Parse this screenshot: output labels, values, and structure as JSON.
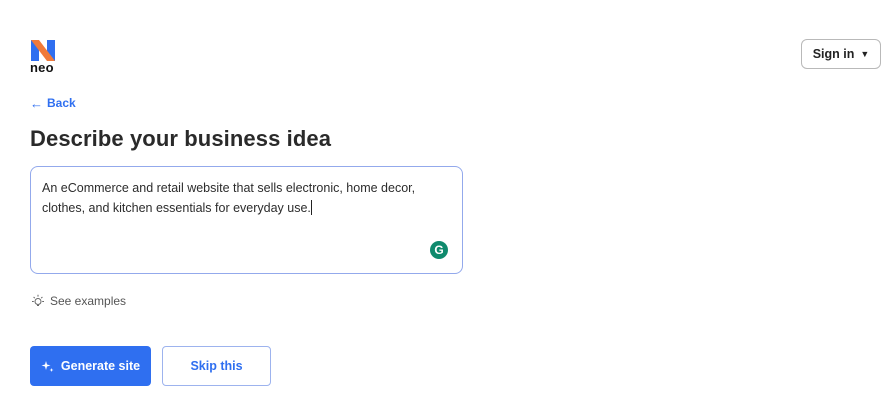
{
  "header": {
    "logo_text": "neo",
    "signin_label": "Sign in",
    "signin_caret": "▼"
  },
  "nav": {
    "back_arrow": "←",
    "back_label": "Back"
  },
  "main": {
    "title": "Describe your business idea",
    "description_value": "An eCommerce and retail website that sells electronic, home decor, clothes, and kitchen essentials for everyday use.",
    "grammarly_letter": "G",
    "examples_label": "See examples"
  },
  "actions": {
    "generate_label": "Generate site",
    "skip_label": "Skip this"
  },
  "colors": {
    "accent": "#2f6ff0",
    "logo_blue": "#2f6ff0",
    "logo_orange": "#f07a3a",
    "grammarly_green": "#0f8a6d"
  },
  "icons": {
    "logo": "neo-logo-icon",
    "back": "arrow-left-icon",
    "examples": "lightbulb-icon",
    "generate": "sparkle-icon",
    "grammarly": "grammarly-icon",
    "signin": "caret-down-icon"
  }
}
